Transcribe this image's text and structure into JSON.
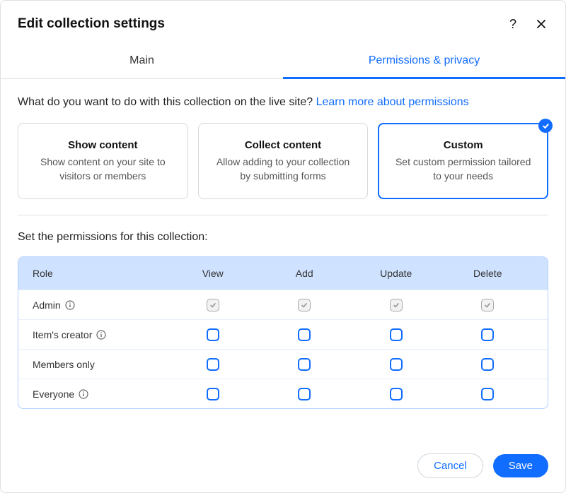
{
  "header": {
    "title": "Edit collection settings"
  },
  "tabs": {
    "main": "Main",
    "permissions": "Permissions & privacy"
  },
  "question": {
    "text": "What do you want to do with this collection on the live site? ",
    "link": "Learn more about permissions"
  },
  "cards": {
    "show": {
      "title": "Show content",
      "desc": "Show content on your site to visitors or members"
    },
    "collect": {
      "title": "Collect content",
      "desc": "Allow adding to your collection by submitting forms"
    },
    "custom": {
      "title": "Custom",
      "desc": "Set custom permission tailored to your needs"
    }
  },
  "permHeading": "Set the permissions for this collection:",
  "table": {
    "columns": {
      "role": "Role",
      "view": "View",
      "add": "Add",
      "update": "Update",
      "delete": "Delete"
    },
    "rows": {
      "admin": "Admin",
      "creator": "Item's creator",
      "members": "Members only",
      "everyone": "Everyone"
    }
  },
  "footer": {
    "cancel": "Cancel",
    "save": "Save"
  }
}
